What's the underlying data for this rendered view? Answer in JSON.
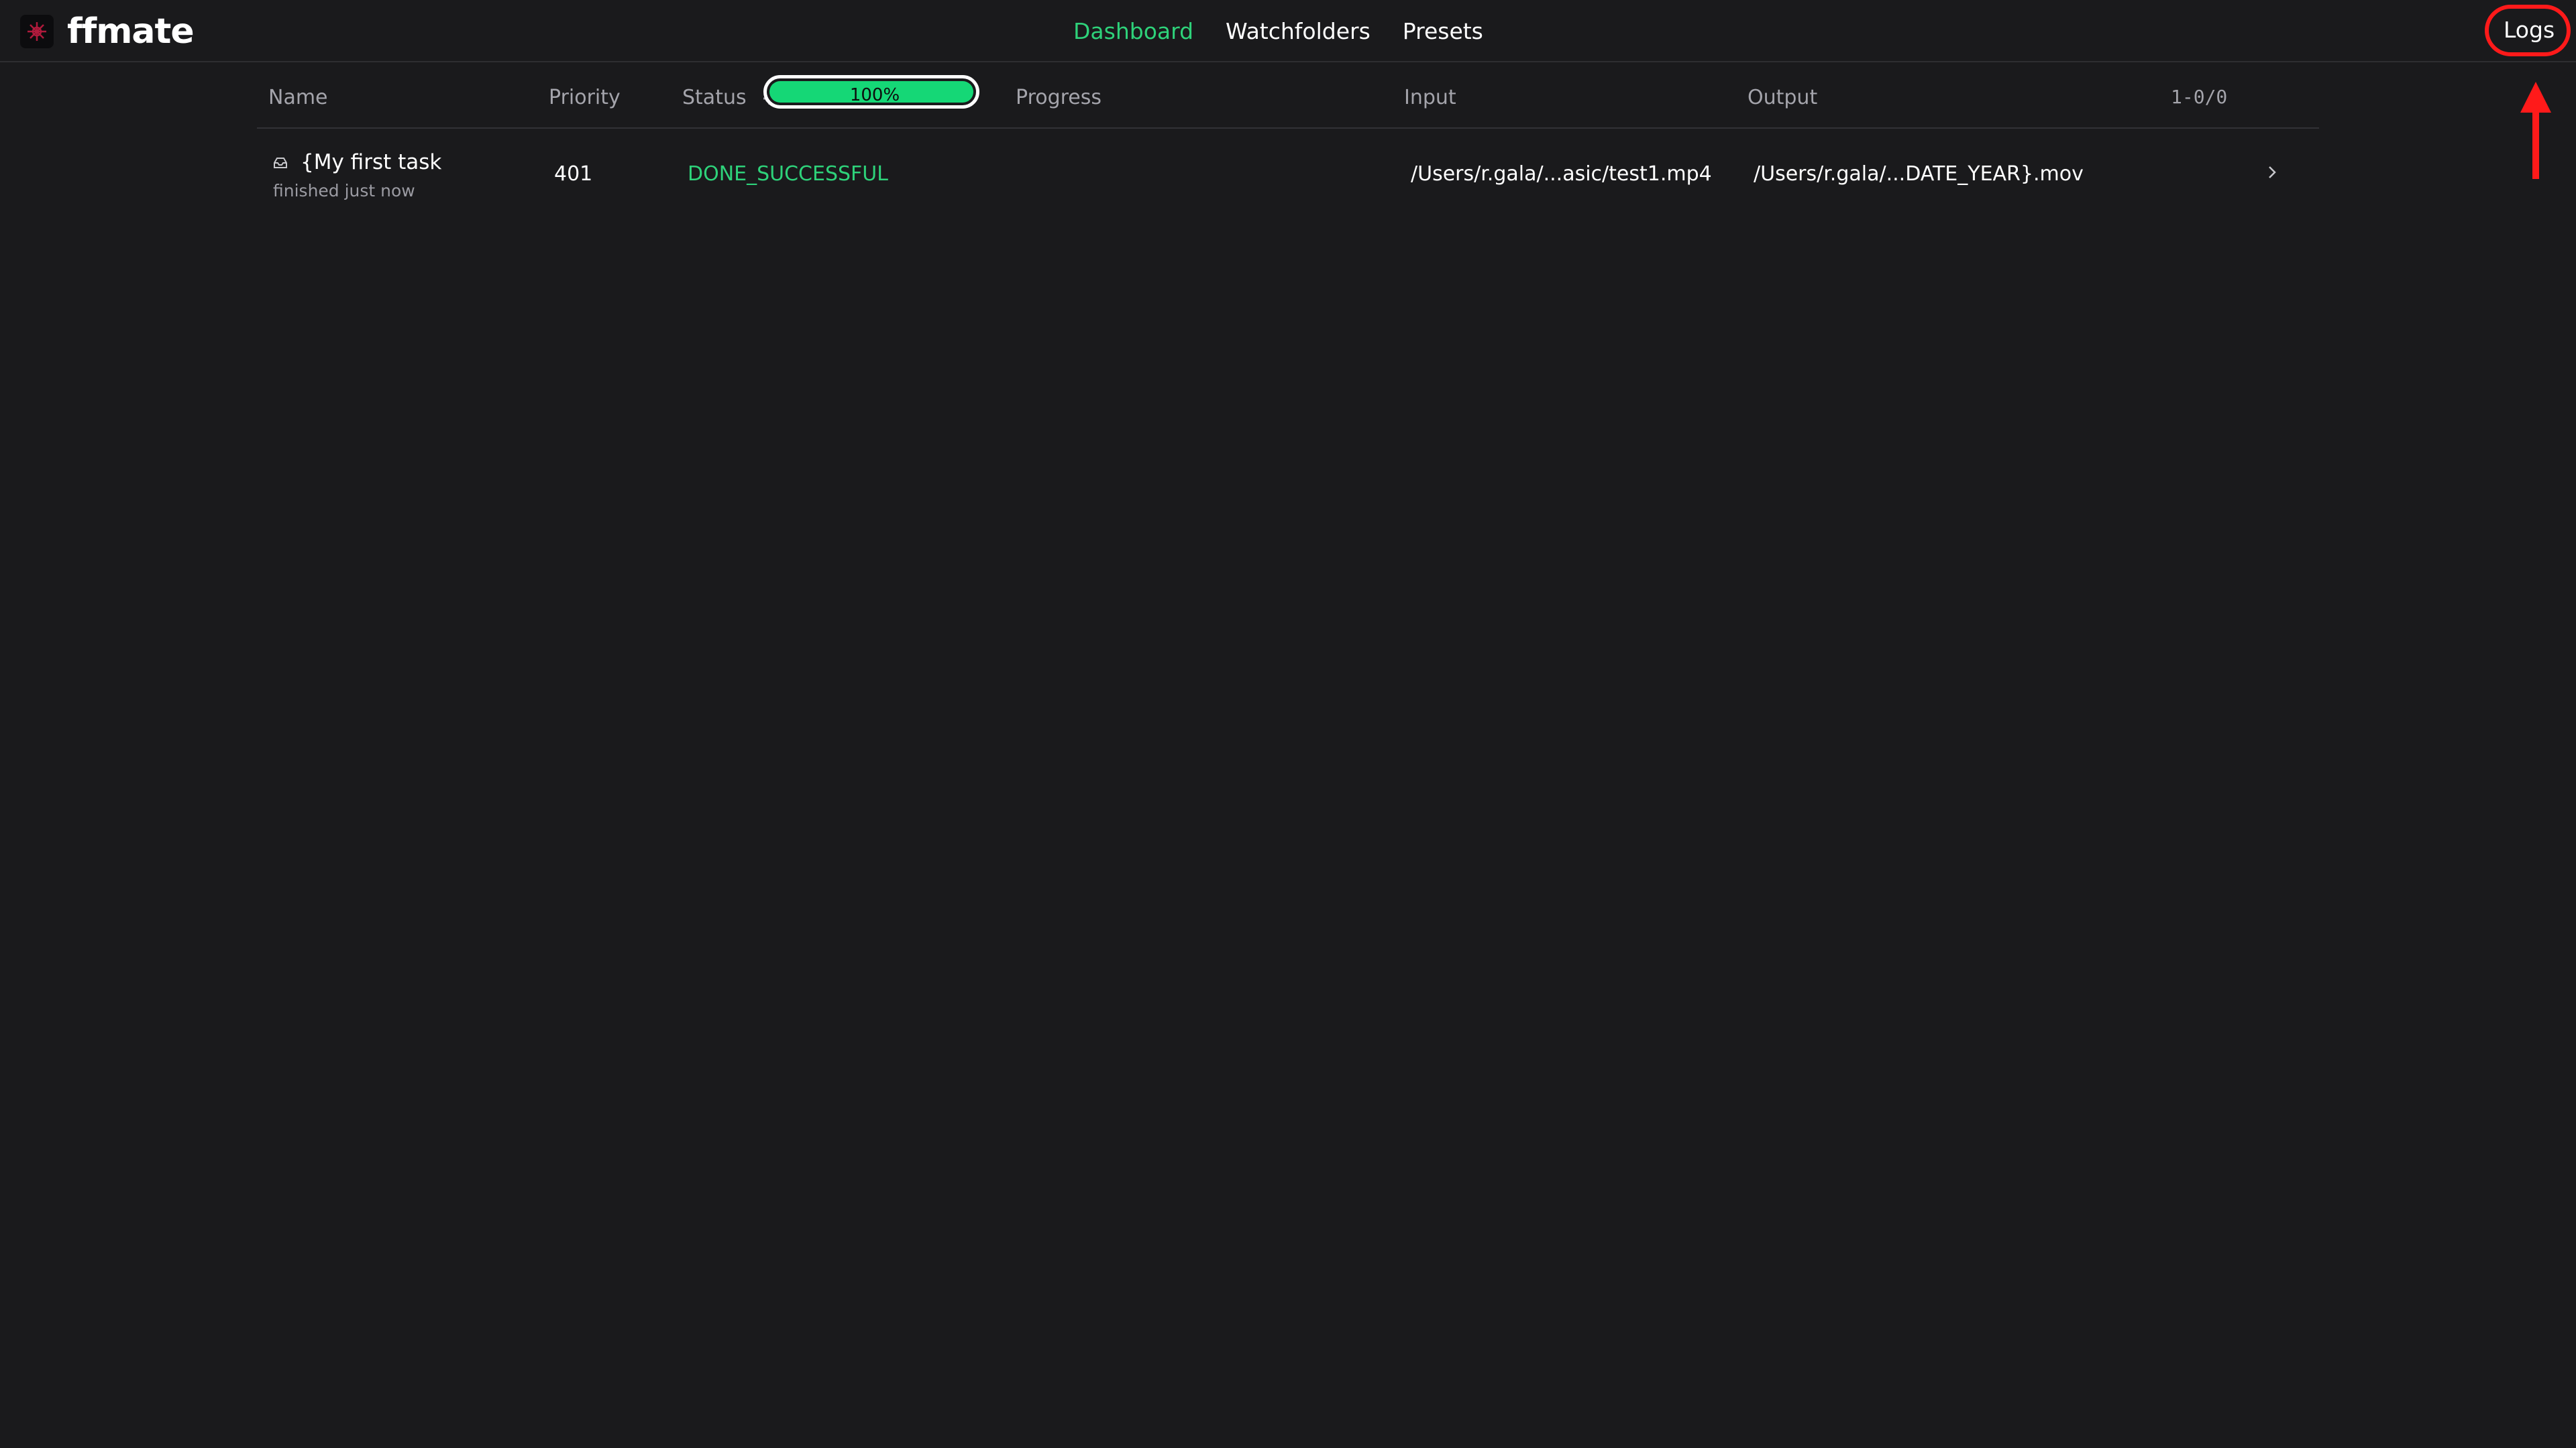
{
  "app": {
    "name": "ffmate",
    "accent_color": "#2ed27a",
    "logo_icon": "ffmate-logo-icon"
  },
  "nav": {
    "items": [
      {
        "label": "Dashboard",
        "active": true
      },
      {
        "label": "Watchfolders",
        "active": false
      },
      {
        "label": "Presets",
        "active": false
      }
    ],
    "logs_label": "Logs"
  },
  "table": {
    "columns": {
      "name": "Name",
      "priority": "Priority",
      "status": "Status",
      "progress": "Progress",
      "input": "Input",
      "output": "Output"
    },
    "status_filter_icon": "gear-icon",
    "count": "1-0/0",
    "rows": [
      {
        "name": "{My first task",
        "finished": "finished just now",
        "priority": "401",
        "status": "DONE_SUCCESSFUL",
        "status_color": "#2ed27a",
        "progress_percent": 100,
        "progress_label": "100%",
        "input": "/Users/r.gala/...asic/test1.mp4",
        "output": "/Users/r.gala/...DATE_YEAR}.mov",
        "row_icon": "inbox-icon",
        "open_icon": "chevron-right-icon"
      }
    ]
  },
  "annotation": {
    "color": "#ff1a1a"
  }
}
